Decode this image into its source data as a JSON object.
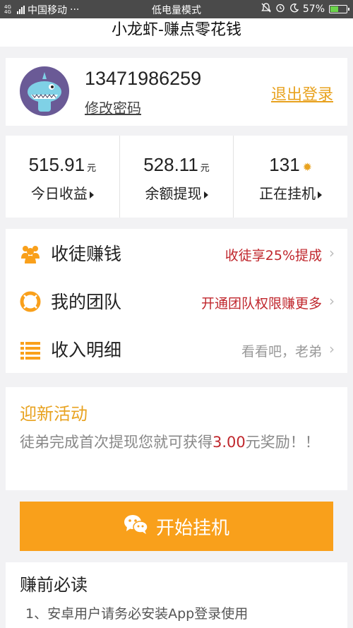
{
  "status_bar": {
    "network": "4G 4G",
    "carrier": "中国移动",
    "dots": "···",
    "mode": "低电量模式",
    "battery": "57%",
    "battery_level": 0.57
  },
  "app": {
    "title": "小龙虾-赚点零花钱"
  },
  "account": {
    "phone": "13471986259",
    "change_password": "修改密码",
    "logout": "退出登录"
  },
  "stats": [
    {
      "value": "515.91",
      "unit": "元",
      "label": "今日收益"
    },
    {
      "value": "528.11",
      "unit": "元",
      "label": "余额提现"
    },
    {
      "value": "131",
      "unit": "",
      "label": "正在挂机"
    }
  ],
  "menu": [
    {
      "label": "收徒赚钱",
      "hint": "收徒享25%提成",
      "icon": "people-icon"
    },
    {
      "label": "我的团队",
      "hint": "开通团队权限赚更多",
      "icon": "lifebuoy-icon"
    },
    {
      "label": "收入明细",
      "hint": "看看吧，老弟",
      "icon": "list-icon"
    }
  ],
  "promo": {
    "title": "迎新活动",
    "text_before": "徒弟完成首次提现您就可获得",
    "amount": "3.00",
    "text_after": "元奖励！！"
  },
  "start_button": {
    "label": "开始挂机",
    "icon": "wechat-icon"
  },
  "notice": {
    "title": "赚前必读",
    "line1": "1、安卓用户请务必安装App登录使用"
  },
  "colors": {
    "accent": "#f9a01b",
    "accent_text": "#e8a21f",
    "red": "#c0272d",
    "avatar_bg": "#6a5a96"
  }
}
